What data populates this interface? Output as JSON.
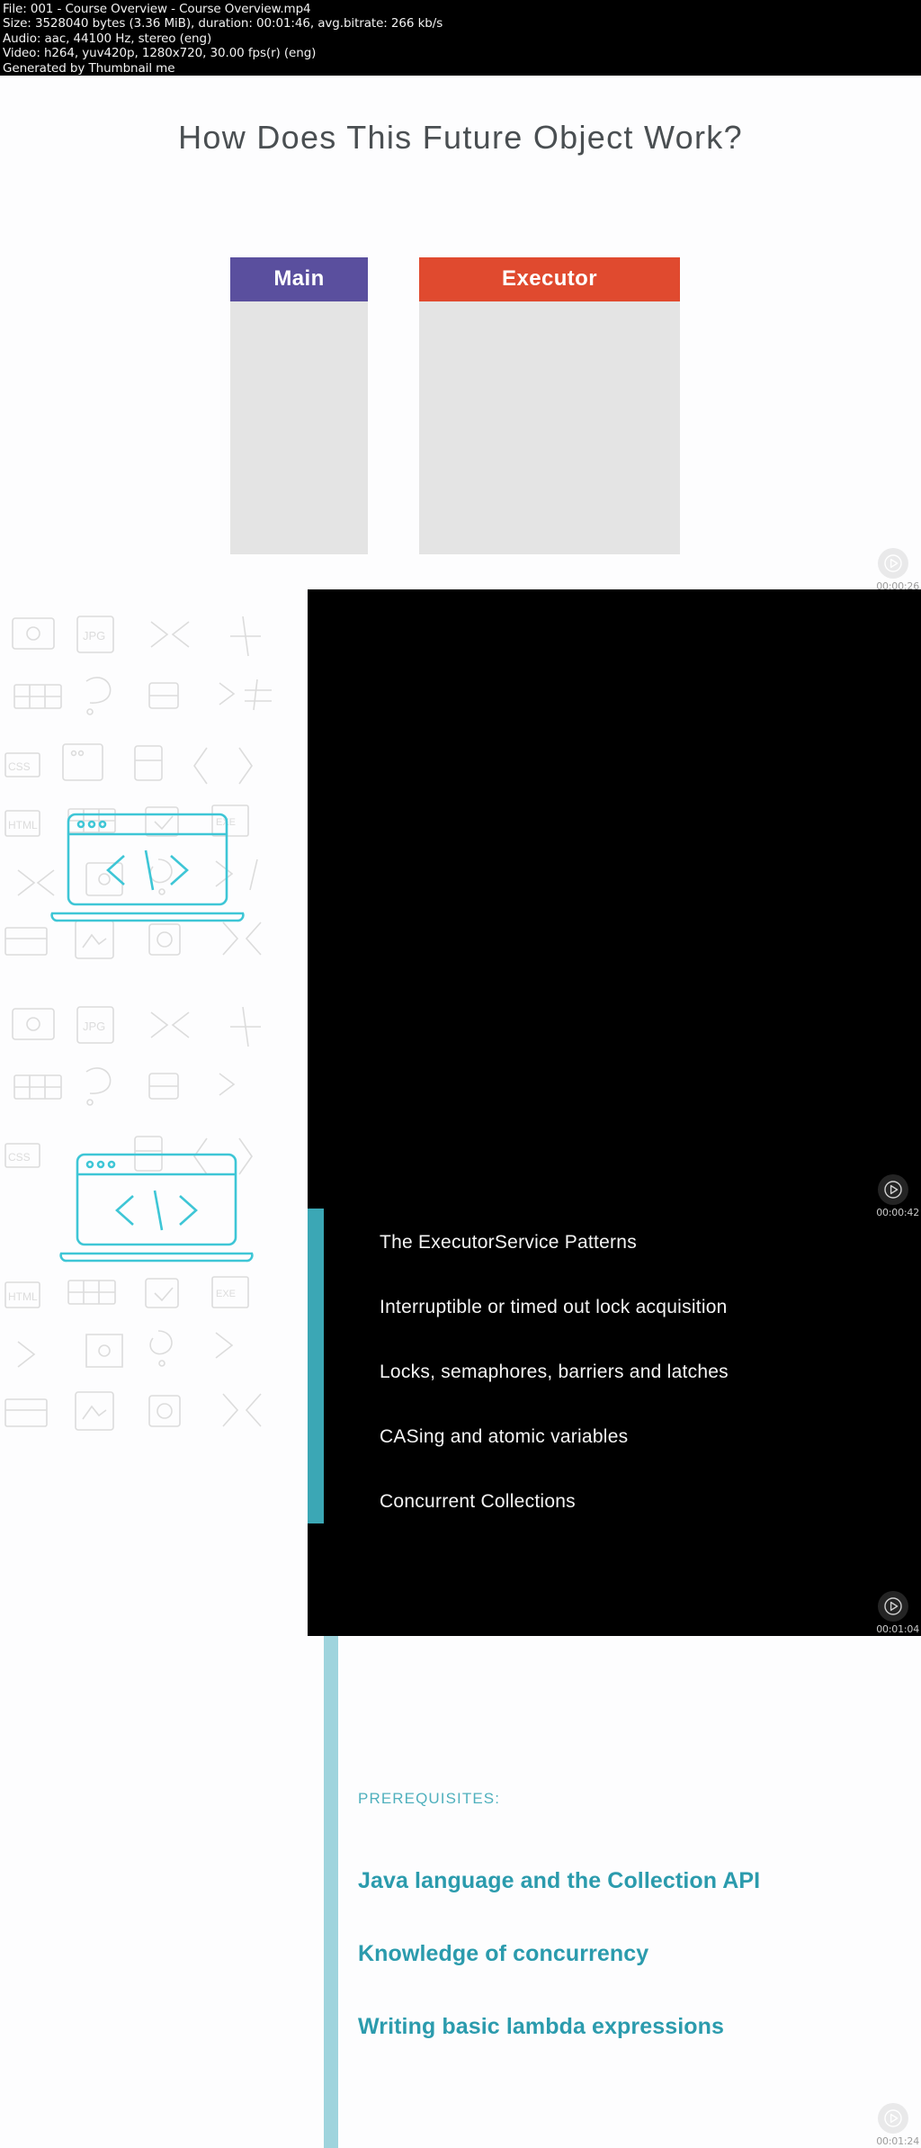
{
  "meta": {
    "file_line": "File: 001 - Course Overview - Course Overview.mp4",
    "size_line": "Size: 3528040 bytes (3.36 MiB), duration: 00:01:46, avg.bitrate: 266 kb/s",
    "audio_line": "Audio: aac, 44100 Hz, stereo (eng)",
    "video_line": "Video: h264, yuv420p, 1280x720, 30.00 fps(r) (eng)",
    "generator_line": "Generated by Thumbnail me"
  },
  "frames": [
    {
      "name": "title-slide",
      "timestamp": "00:00:26",
      "slide_title": "How Does This Future Object Work?",
      "columns": [
        {
          "label": "Main",
          "color": "#5a4f9e"
        },
        {
          "label": "Executor",
          "color": "#e04a2f"
        }
      ]
    },
    {
      "name": "dark-slide-upper",
      "timestamp": "00:00:42"
    },
    {
      "name": "agenda-slide",
      "timestamp": "00:01:04",
      "accent_color": "#3ba7b5",
      "items": [
        "The ExecutorService Patterns",
        "Interruptible or timed out lock acquisition",
        "Locks, semaphores, barriers and latches",
        "CASing and atomic variables",
        "Concurrent Collections"
      ]
    },
    {
      "name": "prerequisites-slide",
      "timestamp": "00:01:24",
      "accent_color": "#9fd4dd",
      "heading": "PREREQUISITES:",
      "items": [
        "Java language and the Collection API",
        "Knowledge of concurrency",
        "Writing basic lambda expressions"
      ]
    }
  ],
  "icons": {
    "play": "play-circle-icon"
  }
}
